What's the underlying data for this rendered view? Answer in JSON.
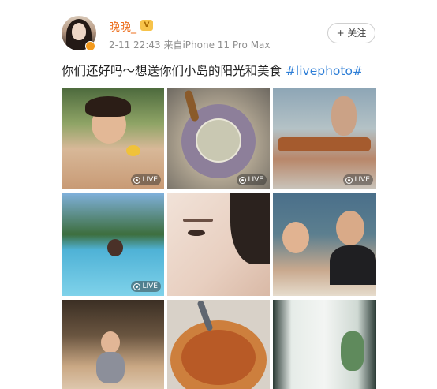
{
  "post": {
    "username": "晚晚_",
    "vip_badge": "V",
    "meta": "2-11 22:43  来自iPhone 11 Pro Max",
    "follow_label": "+ 关注",
    "text": "你们还好吗～想送你们小岛的阳光和美食 ",
    "hashtag": "#livephoto#"
  },
  "photos": [
    {
      "live": "LIVE"
    },
    {
      "live": "LIVE"
    },
    {
      "live": "LIVE"
    },
    {
      "live": "LIVE"
    },
    {
      "live": ""
    },
    {
      "live": ""
    },
    {
      "live": ""
    },
    {
      "live": ""
    },
    {
      "live": ""
    }
  ],
  "colors": {
    "username": "#ec6f1e",
    "hashtag": "#2c7dd6",
    "meta": "#8f8f8f"
  },
  "icons": {
    "verify": "verified-badge-icon",
    "vip": "vip-badge-icon",
    "live": "live-photo-icon"
  }
}
